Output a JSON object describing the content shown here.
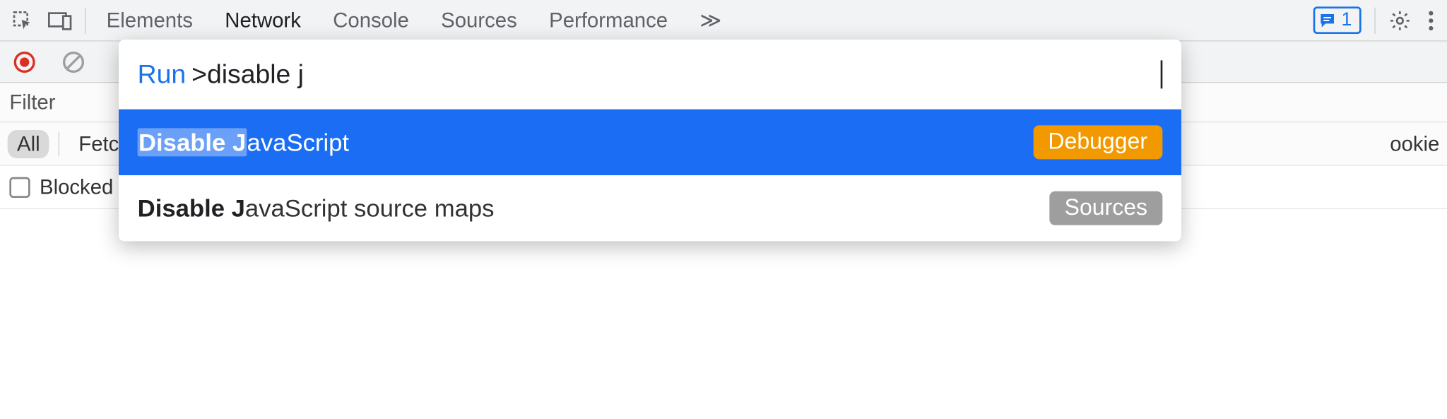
{
  "tabs": {
    "items": [
      "Elements",
      "Network",
      "Console",
      "Sources",
      "Performance"
    ],
    "selected": "Network",
    "overflow_glyph": "≫"
  },
  "issues": {
    "count": "1"
  },
  "toolbar": {
    "filter_placeholder": "Filter"
  },
  "filters": {
    "all": "All",
    "fetch": "Fetch",
    "cookies_fragment": "ookie"
  },
  "blocked": {
    "label": "Blocked"
  },
  "palette": {
    "prefix": "Run",
    "input_value": ">disable j",
    "items": [
      {
        "match_bold": "Disable J",
        "rest": "avaScript",
        "badge": "Debugger",
        "badge_color": "orange",
        "selected": true
      },
      {
        "match_bold": "Disable J",
        "rest": "avaScript source maps",
        "badge": "Sources",
        "badge_color": "gray",
        "selected": false
      }
    ]
  }
}
